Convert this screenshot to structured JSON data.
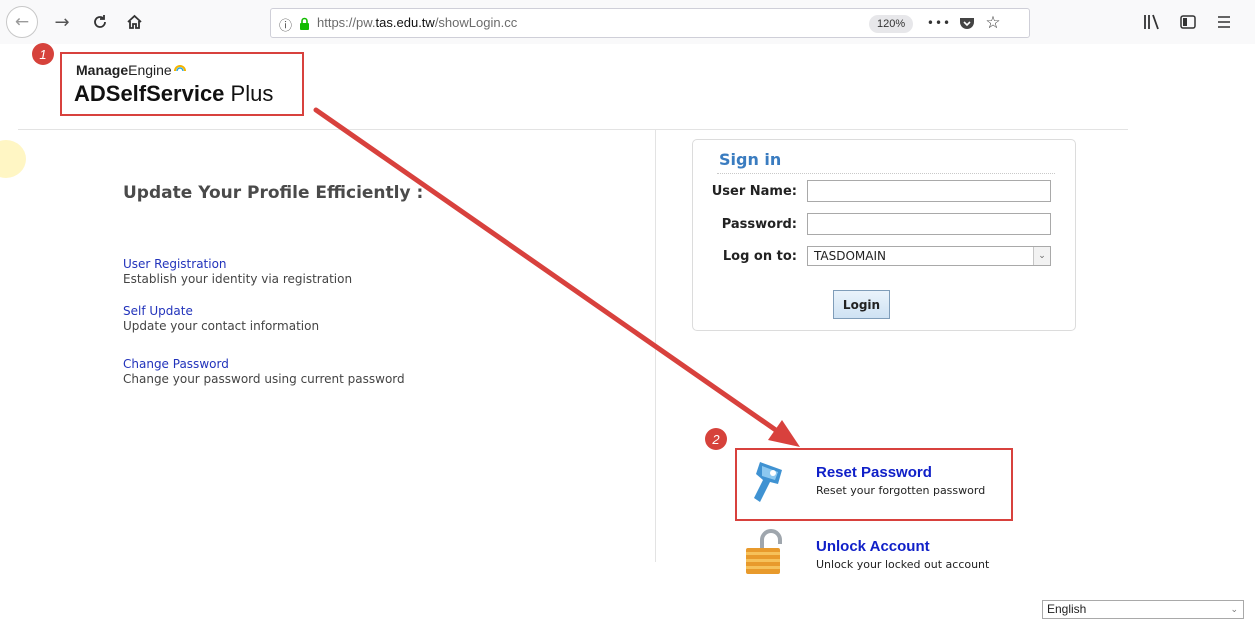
{
  "browser": {
    "url_prefix": "https://pw.",
    "url_domain": "tas.edu.tw",
    "url_path": "/showLogin.cc",
    "zoom": "120%",
    "info_icon": "info-icon",
    "more_icon": "•••"
  },
  "annotations": {
    "step1": "1",
    "step2": "2",
    "color": "#d8413d"
  },
  "logo": {
    "brand_bold": "Manage",
    "brand_rest": "Engine",
    "product_bold": "ADSelfService",
    "product_rest": " Plus"
  },
  "left": {
    "tagline": "Update Your Profile Efficiently :",
    "features": [
      {
        "link": "User Registration",
        "desc": "Establish your identity via registration"
      },
      {
        "link": "Self Update",
        "desc": "Update your contact information"
      },
      {
        "link": "Change Password",
        "desc": "Change your password using current password"
      }
    ]
  },
  "signin": {
    "title": "Sign in",
    "username_label": "User Name:",
    "password_label": "Password:",
    "logon_label": "Log on to:",
    "domain_value": "TASDOMAIN",
    "login_button": "Login"
  },
  "actions": {
    "reset": {
      "title": "Reset Password",
      "desc": "Reset your forgotten password"
    },
    "unlock": {
      "title": "Unlock Account",
      "desc": "Unlock your locked out account"
    }
  },
  "language": {
    "selected": "English"
  },
  "colors": {
    "link": "#2233bb",
    "action_link": "#1020c8",
    "signin_title": "#3a7cc0"
  }
}
